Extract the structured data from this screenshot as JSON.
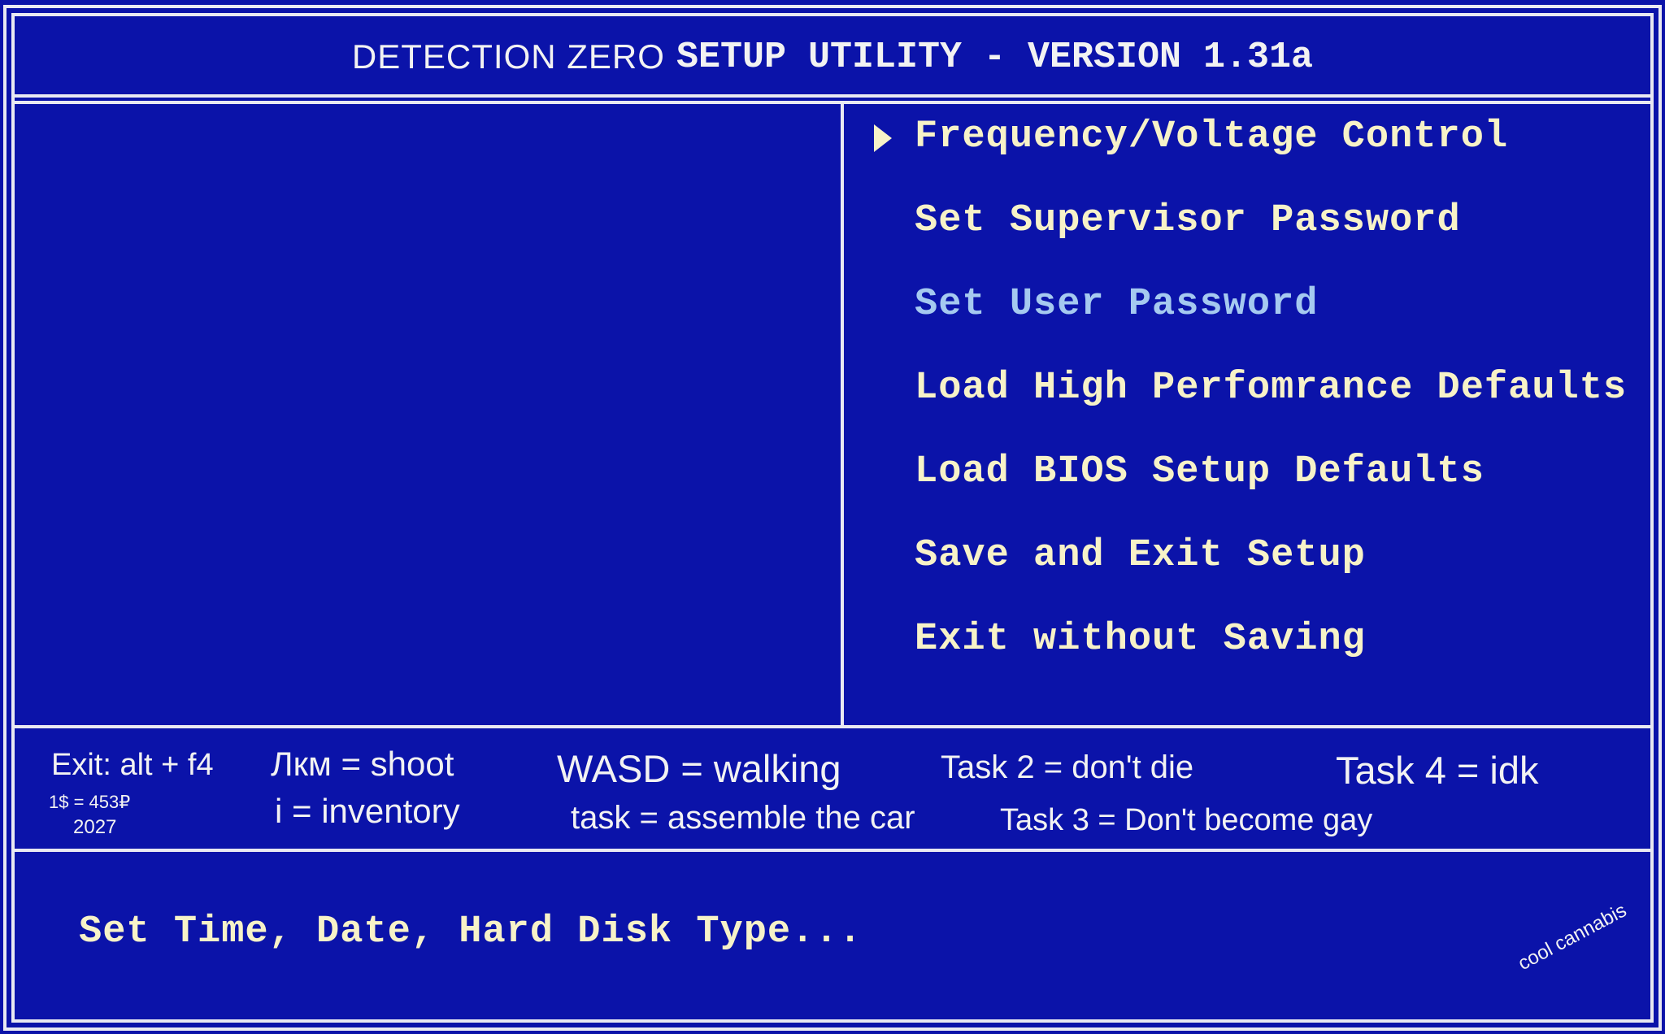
{
  "header": {
    "brand": "DETECTION ZERO",
    "title": "SETUP UTILITY - VERSION 1.31a"
  },
  "menu": {
    "items": [
      {
        "label": "Frequency/Voltage Control",
        "selected": true
      },
      {
        "label": "Set Supervisor Password"
      },
      {
        "label": "Set User Password",
        "dimmed": true
      },
      {
        "label": "Load High Perfomrance Defaults"
      },
      {
        "label": "Load BIOS Setup Defaults"
      },
      {
        "label": "Save and Exit Setup"
      },
      {
        "label": "Exit without Saving"
      }
    ]
  },
  "hints": {
    "exit": "Exit: alt + f4",
    "rate": "1$ = 453₽",
    "year": "2027",
    "shoot": "Лкм = shoot",
    "inventory": "i = inventory",
    "walking": "WASD = walking",
    "task": "task = assemble the car",
    "task2": "Task 2 = don't die",
    "task3": "Task 3 = Don't become gay",
    "task4": "Task 4 = idk"
  },
  "status": {
    "text": "Set Time, Date, Hard Disk Type..."
  },
  "watermark": "cool cannabis",
  "colors": {
    "background": "#0b13a9",
    "border": "#e9e9f2",
    "menu_text": "#f7f2c8",
    "menu_text_dimmed": "#a5c9f0"
  }
}
